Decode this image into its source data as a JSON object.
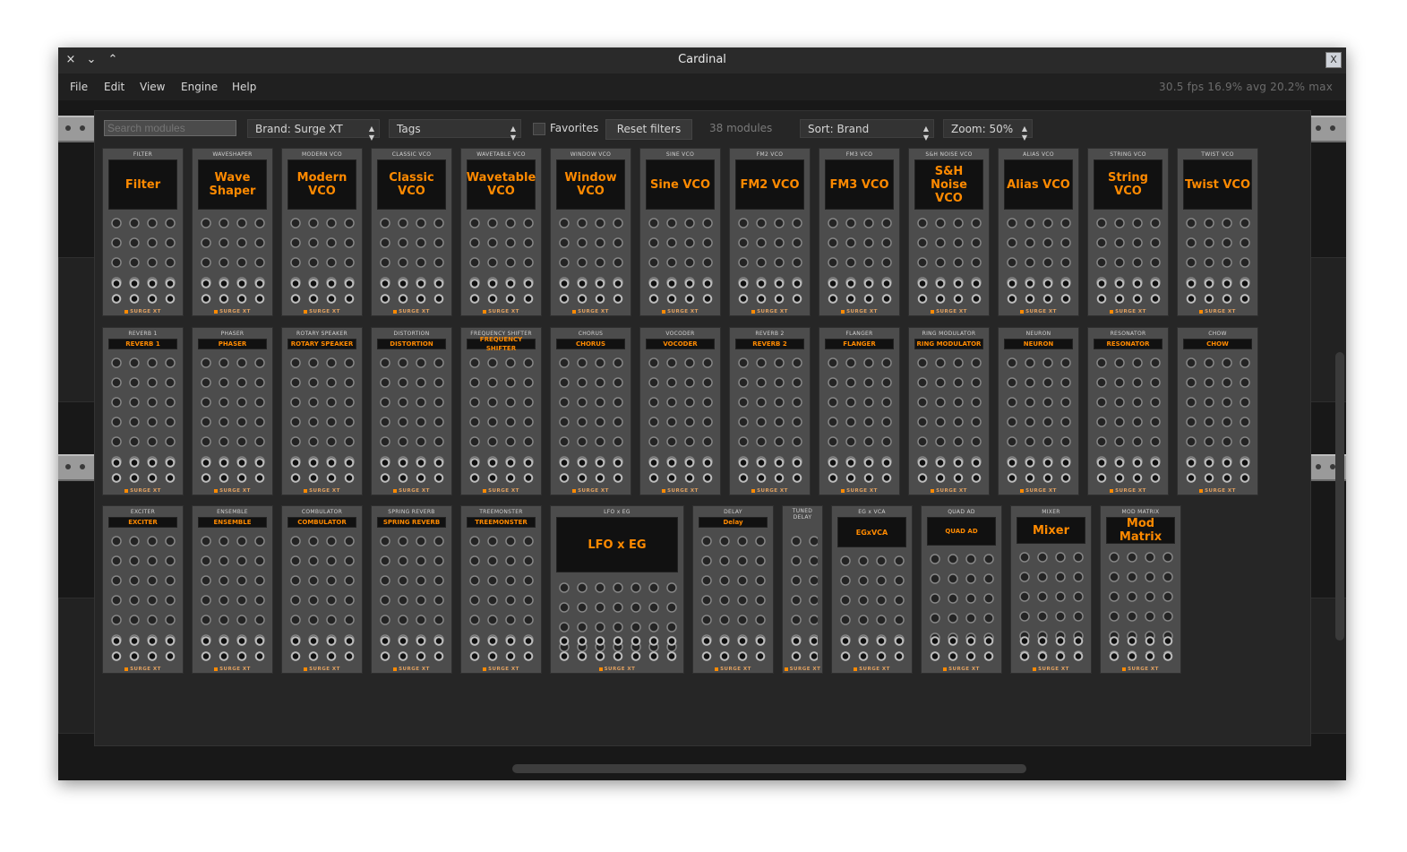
{
  "window": {
    "title": "Cardinal",
    "close_icon": "×",
    "minimize_icon": "⌄",
    "maximize_icon": "⌃",
    "logo_icon": "X"
  },
  "menu": {
    "items": [
      "File",
      "Edit",
      "View",
      "Engine",
      "Help"
    ]
  },
  "stats": "30.5 fps  16.9% avg  20.2% max",
  "browser": {
    "search_placeholder": "Search modules",
    "brand_select": "Brand: Surge XT",
    "tags_select": "Tags",
    "favorites_label": "Favorites",
    "reset_label": "Reset filters",
    "count_label": "38 modules",
    "sort_select": "Sort: Brand",
    "zoom_select": "Zoom: 50%"
  },
  "modules_row1": [
    {
      "name": "FILTER",
      "display": "Filter"
    },
    {
      "name": "WAVESHAPER",
      "display": "Wave Shaper"
    },
    {
      "name": "MODERN VCO",
      "display": "Modern VCO"
    },
    {
      "name": "CLASSIC VCO",
      "display": "Classic VCO"
    },
    {
      "name": "WAVETABLE VCO",
      "display": "Wavetable VCO"
    },
    {
      "name": "WINDOW VCO",
      "display": "Window VCO"
    },
    {
      "name": "SINE VCO",
      "display": "Sine VCO"
    },
    {
      "name": "FM2 VCO",
      "display": "FM2 VCO"
    },
    {
      "name": "FM3 VCO",
      "display": "FM3 VCO"
    },
    {
      "name": "S&H NOISE VCO",
      "display": "S&H Noise VCO"
    },
    {
      "name": "ALIAS VCO",
      "display": "Alias VCO"
    },
    {
      "name": "STRING VCO",
      "display": "String VCO"
    },
    {
      "name": "TWIST VCO",
      "display": "Twist VCO"
    }
  ],
  "modules_row2": [
    {
      "name": "REVERB 1",
      "display": "REVERB 1"
    },
    {
      "name": "PHASER",
      "display": "PHASER"
    },
    {
      "name": "ROTARY SPEAKER",
      "display": "ROTARY SPEAKER"
    },
    {
      "name": "DISTORTION",
      "display": "DISTORTION"
    },
    {
      "name": "FREQUENCY SHIFTER",
      "display": "FREQUENCY SHIFTER"
    },
    {
      "name": "CHORUS",
      "display": "CHORUS"
    },
    {
      "name": "VOCODER",
      "display": "VOCODER"
    },
    {
      "name": "REVERB 2",
      "display": "REVERB 2"
    },
    {
      "name": "FLANGER",
      "display": "FLANGER"
    },
    {
      "name": "RING MODULATOR",
      "display": "RING MODULATOR"
    },
    {
      "name": "NEURON",
      "display": "NEURON"
    },
    {
      "name": "RESONATOR",
      "display": "RESONATOR"
    },
    {
      "name": "CHOW",
      "display": "CHOW"
    }
  ],
  "modules_row3": [
    {
      "name": "EXCITER",
      "display": "EXCITER"
    },
    {
      "name": "ENSEMBLE",
      "display": "ENSEMBLE"
    },
    {
      "name": "COMBULATOR",
      "display": "COMBULATOR"
    },
    {
      "name": "SPRING REVERB",
      "display": "SPRING REVERB"
    },
    {
      "name": "TREEMONSTER",
      "display": "TREEMONSTER"
    },
    {
      "name": "LFO x EG",
      "display": "LFO x EG"
    },
    {
      "name": "DELAY",
      "display": "Delay"
    },
    {
      "name": "TUNED DELAY",
      "display": ""
    },
    {
      "name": "EG x VCA",
      "display": "EGxVCA"
    },
    {
      "name": "QUAD AD",
      "display": "QUAD AD"
    },
    {
      "name": "MIXER",
      "display": "Mixer"
    },
    {
      "name": "MOD MATRIX",
      "display": "Mod Matrix"
    }
  ],
  "brand_footer": "SURGE XT"
}
